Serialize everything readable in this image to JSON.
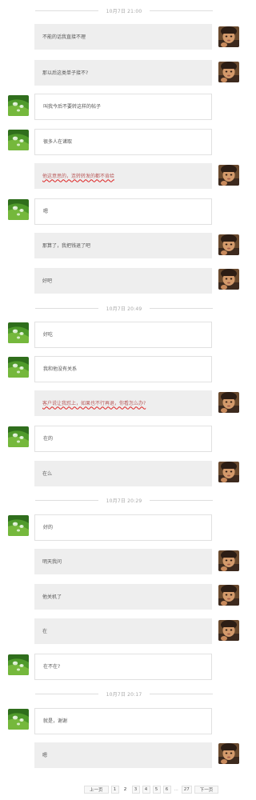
{
  "timestamps": [
    "10月7日 21:00",
    "10月7日 20:49",
    "10月7日 20:29",
    "10月7日 20:17"
  ],
  "messages": [
    {
      "side": "me",
      "text": "不能的话我直接不理"
    },
    {
      "side": "me",
      "text": "那以后这类单子接不?"
    },
    {
      "side": "other",
      "text": "叫我今后不要转这样的帖子"
    },
    {
      "side": "other",
      "text": "很多人在诸取"
    },
    {
      "side": "me",
      "text": "他这意思的，连转转发的都不肯给",
      "flagged": true
    },
    {
      "side": "other",
      "text": "嗯"
    },
    {
      "side": "me",
      "text": "那算了，我把钱退了吧"
    },
    {
      "side": "me",
      "text": "好吧"
    },
    {
      "side": "other",
      "text": "好吃"
    },
    {
      "side": "other",
      "text": "我和他没有关系"
    },
    {
      "side": "me",
      "text": "客户说让我怼上，如果也不行再退，你看怎么办?",
      "flagged": true
    },
    {
      "side": "other",
      "text": "在的"
    },
    {
      "side": "me",
      "text": "在么"
    },
    {
      "side": "other",
      "text": "好的"
    },
    {
      "side": "me",
      "text": "明天我问"
    },
    {
      "side": "me",
      "text": "他关机了"
    },
    {
      "side": "me",
      "text": "在"
    },
    {
      "side": "other",
      "text": "在不在?"
    },
    {
      "side": "other",
      "text": "就是，谢谢"
    },
    {
      "side": "me",
      "text": "嗯"
    }
  ],
  "pagination": {
    "prev_label": "上一页",
    "pages": [
      "1",
      "2",
      "3",
      "4",
      "5",
      "6"
    ],
    "current": "2",
    "ellipsis": "...",
    "last": "27",
    "next_label": "下一页"
  },
  "avatars": {
    "me": "child-portrait-avatar",
    "other": "water-drops-on-leaf-avatar"
  }
}
